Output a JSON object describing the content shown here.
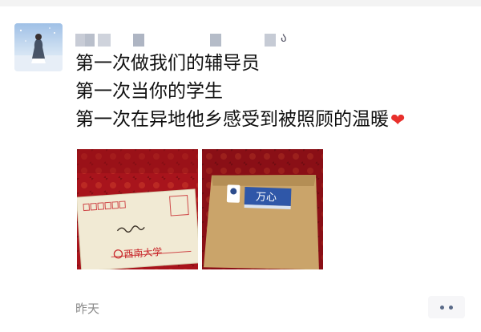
{
  "post": {
    "lines": [
      "第一次做我们的辅导员",
      "第一次当你的学生",
      "第一次在异地他乡感受到被照顾的温暖"
    ],
    "emoji": "heart-icon"
  },
  "author": {
    "name_glyph": "ა"
  },
  "photos": [
    {
      "icon": "envelope-photo",
      "handwriting": "黄佳宁",
      "seal_text": "西南大学"
    },
    {
      "icon": "envelope-photo",
      "label_text": "万心"
    }
  ],
  "meta": {
    "time": "昨天",
    "more_icon": "more-dots-icon"
  },
  "colors": {
    "heart": "#e8302c",
    "more_dots": "#5a6a88",
    "time": "#8a8a8a"
  }
}
